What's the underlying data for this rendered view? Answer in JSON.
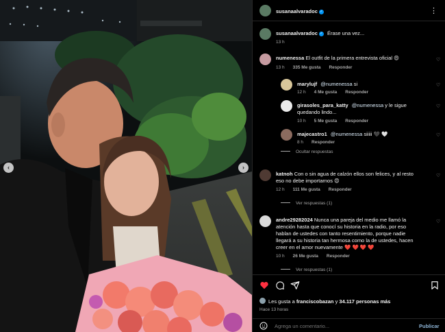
{
  "post": {
    "username": "susanaalvaradoc",
    "caption": "Érase una vez...",
    "caption_time": "13 h",
    "likes_text_prefix": "Les gusta a",
    "likes_user": "franciscobazan",
    "likes_connector": "y",
    "likes_count": "34.117 personas más",
    "time_ago": "Hace 13 horas",
    "comment_placeholder": "Agrega un comentario...",
    "publish_label": "Publicar",
    "more_icon": "more-horizontal-icon"
  },
  "comments": [
    {
      "user": "numenessa",
      "text": "El outfit de la primera entrevista oficial 😍",
      "time": "13 h",
      "likes": "335 Me gusta",
      "reply": "Responder"
    },
    {
      "user": "marylujf",
      "mention": "@numenessa",
      "text": "si",
      "time": "12 h",
      "likes": "4 Me gusta",
      "reply": "Responder"
    },
    {
      "user": "girasoles_para_katty",
      "mention": "@numenessa",
      "text": "y le sigue",
      "text2": "quedando lindo...",
      "time": "10 h",
      "likes": "5 Me gusta",
      "reply": "Responder"
    },
    {
      "user": "majecastro1",
      "mention": "@numenessa",
      "text": "siiiii 🖤 🤍",
      "time": "8 h",
      "reply": "Responder"
    },
    {
      "user": "katnoh",
      "text": "Con o sin agua de calzón ellos son felices, y al resto",
      "text2": "eso no debe importarnos 😍",
      "time": "12 h",
      "likes": "111 Me gusta",
      "reply": "Responder"
    },
    {
      "user": "andre29282024",
      "text": "Nunca una pareja del medio me llamó la",
      "text2": "atención hasta que conocí su historia en la radio, por eso",
      "text3": "hablan de ustedes con tanto resentimiento, porque nadie",
      "text4": "llegará a su historia tan hermosa como la de ustedes, hacen",
      "text5": "creer en el amor nuevamente ❤️ ❤️ ❤️ ❤️",
      "time": "10 h",
      "likes": "26 Me gusta",
      "reply": "Responder"
    }
  ],
  "threads": {
    "hide_replies": "Ocultar respuestas",
    "view_replies_1": "Ver respuestas (1)",
    "view_replies_2": "Ver respuestas (1)"
  },
  "colors": {
    "background": "#000000",
    "text": "#f5f5f5",
    "secondary": "#a8a8a8",
    "like_red": "#ff3040",
    "verified_blue": "#0095f6",
    "publish": "#0095f6"
  }
}
